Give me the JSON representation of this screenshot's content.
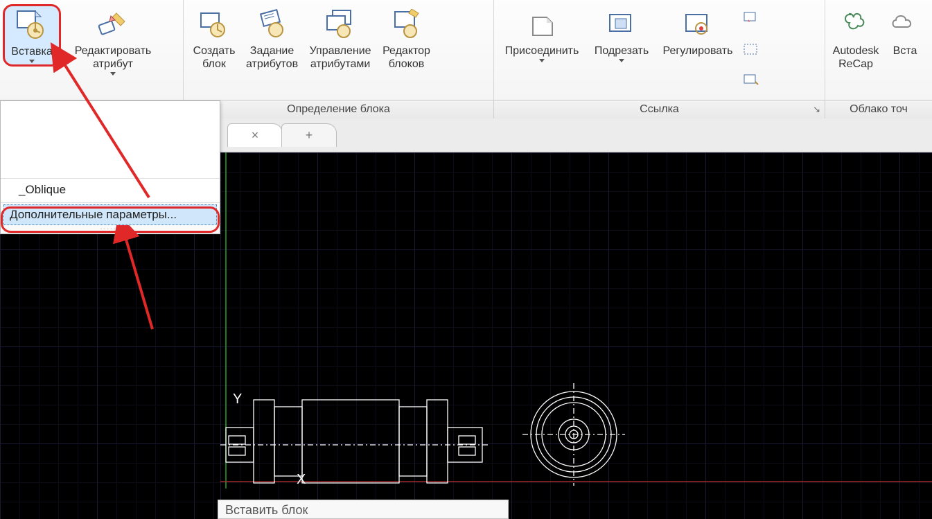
{
  "ribbon": {
    "insert": {
      "label": "Вставка"
    },
    "editAttr": {
      "label": "Редактировать\nатрибут"
    },
    "createBlock": {
      "label": "Создать\nблок"
    },
    "defineAttrs": {
      "label": "Задание\nатрибутов"
    },
    "manageAttrs": {
      "label": "Управление\nатрибутами"
    },
    "blockEditor": {
      "label": "Редактор\nблоков"
    },
    "attach": {
      "label": "Присоединить"
    },
    "clip": {
      "label": "Подрезать"
    },
    "adjust": {
      "label": "Регулировать"
    },
    "recap": {
      "label": "Autodesk\nReCap"
    },
    "insert2": {
      "label": "Вста"
    }
  },
  "panels": {
    "blockDef": "Определение блока",
    "reference": "Ссылка",
    "pointCloud": "Облако точ"
  },
  "dropdown": {
    "oblique": "_Oblique",
    "moreParams": "Дополнительные параметры..."
  },
  "tabs": {
    "close": "×",
    "new": "+"
  },
  "axes": {
    "y": "Y",
    "x": "X"
  },
  "tooltip": {
    "title": "Вставить блок"
  }
}
